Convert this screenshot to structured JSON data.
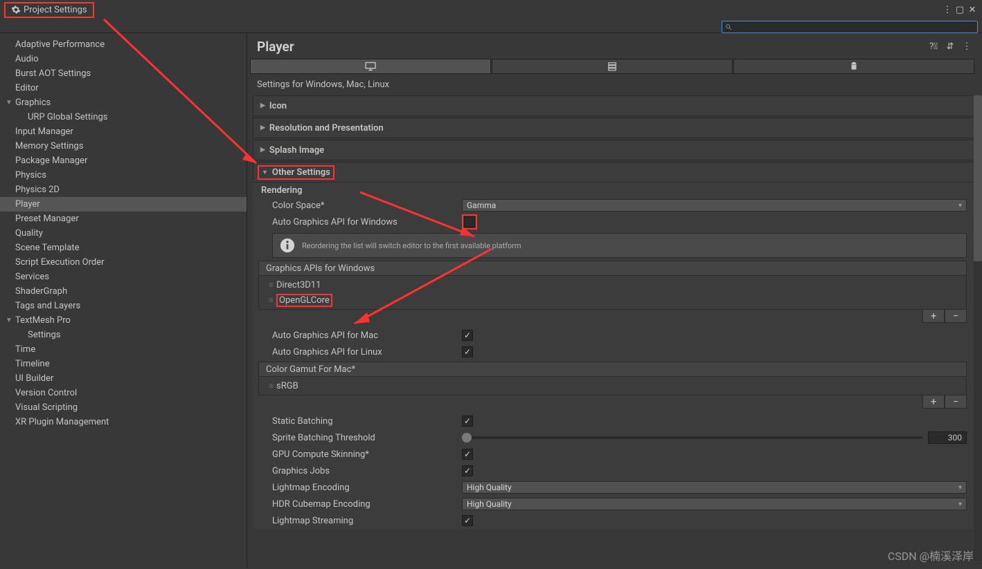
{
  "window": {
    "title": "Project Settings"
  },
  "sidebar": {
    "items": [
      {
        "label": "Adaptive Performance",
        "lvl": 0
      },
      {
        "label": "Audio",
        "lvl": 0
      },
      {
        "label": "Burst AOT Settings",
        "lvl": 0
      },
      {
        "label": "Editor",
        "lvl": 0
      },
      {
        "label": "Graphics",
        "lvl": 0,
        "exp": true
      },
      {
        "label": "URP Global Settings",
        "lvl": 1
      },
      {
        "label": "Input Manager",
        "lvl": 0
      },
      {
        "label": "Memory Settings",
        "lvl": 0
      },
      {
        "label": "Package Manager",
        "lvl": 0
      },
      {
        "label": "Physics",
        "lvl": 0
      },
      {
        "label": "Physics 2D",
        "lvl": 0
      },
      {
        "label": "Player",
        "lvl": 0,
        "sel": true
      },
      {
        "label": "Preset Manager",
        "lvl": 0
      },
      {
        "label": "Quality",
        "lvl": 0
      },
      {
        "label": "Scene Template",
        "lvl": 0
      },
      {
        "label": "Script Execution Order",
        "lvl": 0
      },
      {
        "label": "Services",
        "lvl": 0
      },
      {
        "label": "ShaderGraph",
        "lvl": 0
      },
      {
        "label": "Tags and Layers",
        "lvl": 0
      },
      {
        "label": "TextMesh Pro",
        "lvl": 0,
        "exp": true
      },
      {
        "label": "Settings",
        "lvl": 1
      },
      {
        "label": "Time",
        "lvl": 0
      },
      {
        "label": "Timeline",
        "lvl": 0
      },
      {
        "label": "UI Builder",
        "lvl": 0
      },
      {
        "label": "Version Control",
        "lvl": 0
      },
      {
        "label": "Visual Scripting",
        "lvl": 0
      },
      {
        "label": "XR Plugin Management",
        "lvl": 0
      }
    ]
  },
  "main": {
    "title": "Player",
    "subtitle": "Settings for Windows, Mac, Linux",
    "sections": {
      "icon": "Icon",
      "resolution": "Resolution and Presentation",
      "splash": "Splash Image",
      "other": "Other Settings"
    },
    "rendering": {
      "heading": "Rendering",
      "color_space_label": "Color Space*",
      "color_space_value": "Gamma",
      "auto_api_win": "Auto Graphics API  for Windows",
      "info": "Reordering the list will switch editor to the first available platform",
      "apis_header": "Graphics APIs for Windows",
      "apis": [
        "Direct3D11",
        "OpenGLCore"
      ],
      "auto_api_mac": "Auto Graphics API  for Mac",
      "auto_api_linux": "Auto Graphics API  for Linux",
      "gamut_header": "Color Gamut For Mac*",
      "gamut_items": [
        "sRGB"
      ],
      "static_batch": "Static Batching",
      "sprite_batch": "Sprite Batching Threshold",
      "sprite_val": "300",
      "gpu_skin": "GPU Compute Skinning*",
      "gfx_jobs": "Graphics Jobs",
      "lightmap_enc": "Lightmap Encoding",
      "lightmap_val": "High Quality",
      "hdr_enc": "HDR Cubemap Encoding",
      "hdr_val": "High Quality",
      "lightmap_stream": "Lightmap Streaming"
    }
  },
  "watermark": "CSDN @楠溪泽岸"
}
